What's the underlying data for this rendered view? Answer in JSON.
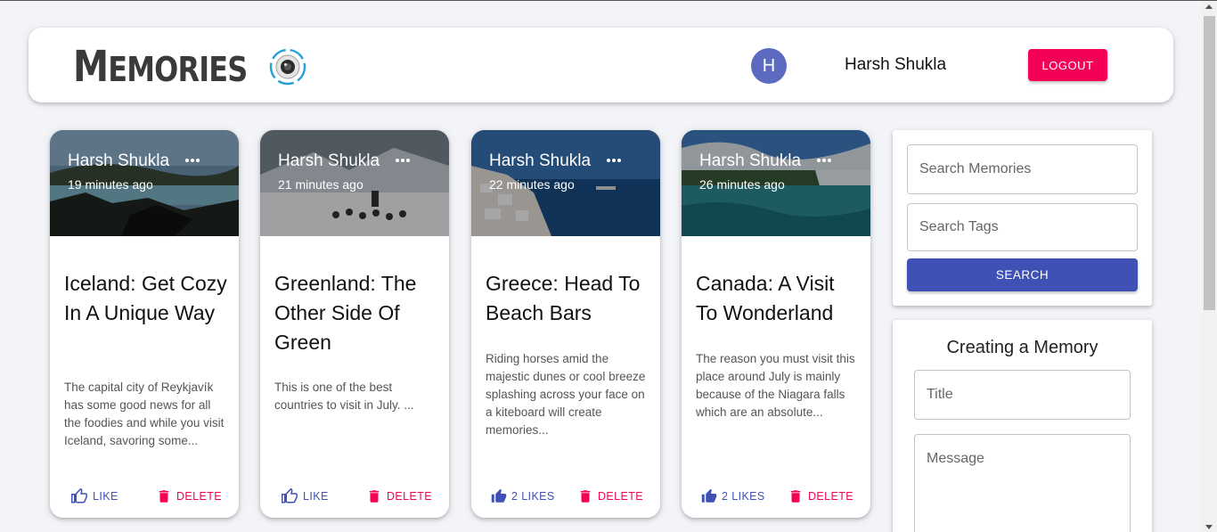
{
  "header": {
    "brand_first": "M",
    "brand_rest": "EMORIES",
    "avatar_letter": "H",
    "user_name": "Harsh Shukla",
    "logout_label": "LOGOUT"
  },
  "posts": [
    {
      "author": "Harsh Shukla",
      "time": "19 minutes ago",
      "title": "Iceland: Get Cozy In A Unique Way",
      "message": "The capital city of Reykjavík has some good news for all the foodies and while you visit Iceland, savoring some...",
      "like_label": "LIKE",
      "delete_label": "DELETE",
      "image": "iceland-lagoon"
    },
    {
      "author": "Harsh Shukla",
      "time": "21 minutes ago",
      "title": "Greenland: The Other Side Of Green",
      "message": "This is one of the best countries to visit in July. ...",
      "like_label": "LIKE",
      "delete_label": "DELETE",
      "image": "greenland-dog-sled"
    },
    {
      "author": "Harsh Shukla",
      "time": "22 minutes ago",
      "title": "Greece: Head To Beach Bars",
      "message": "Riding horses amid the majestic dunes or cool breeze splashing across your face on a kiteboard will create memories...",
      "like_label": "2 LIKES",
      "delete_label": "DELETE",
      "image": "greece-santorini"
    },
    {
      "author": "Harsh Shukla",
      "time": "26 minutes ago",
      "title": "Canada: A Visit To Wonderland",
      "message": "The reason you must visit this place around July is mainly because of the Niagara falls which are an absolute...",
      "like_label": "2 LIKES",
      "delete_label": "DELETE",
      "image": "canada-niagara"
    }
  ],
  "search": {
    "memories_placeholder": "Search Memories",
    "tags_placeholder": "Search Tags",
    "button_label": "SEARCH"
  },
  "form": {
    "heading": "Creating a Memory",
    "title_placeholder": "Title",
    "message_placeholder": "Message"
  },
  "colors": {
    "primary": "#3f51b5",
    "secondary": "#f50057",
    "avatar": "#5c6bc0",
    "background": "#f3f4f8"
  }
}
